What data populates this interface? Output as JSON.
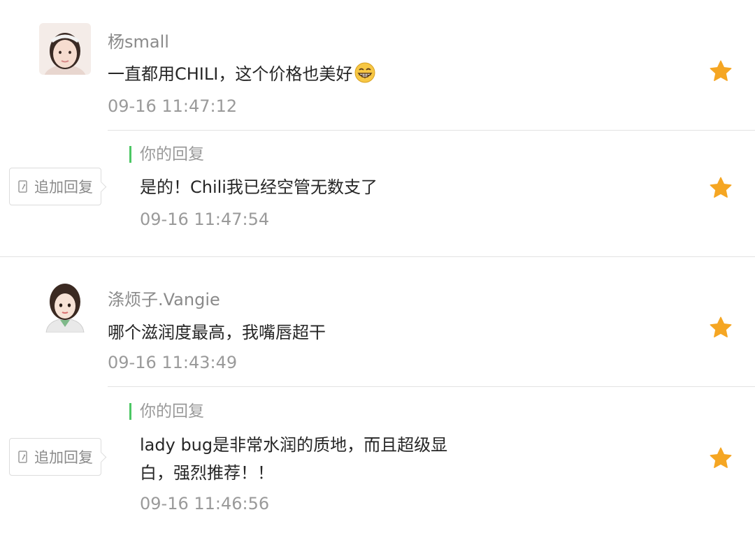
{
  "comments": [
    {
      "username": "杨small",
      "text": "一直都用CHILI，这个价格也美好",
      "emoji": "grinning-face-emoji",
      "time": "09-16 11:47:12",
      "avatar": "avatar-girl-headband",
      "reply": {
        "header": "你的回复",
        "text": "是的！Chili我已经空管无数支了",
        "time": "09-16 11:47:54"
      },
      "add_reply_label": "追加回复"
    },
    {
      "username": "涤烦子.Vangie",
      "text": "哪个滋润度最高，我嘴唇超干",
      "time": "09-16 11:43:49",
      "avatar": "avatar-girl-cartoon",
      "reply": {
        "header": "你的回复",
        "text": "lady bug是非常水润的质地，而且超级显白，强烈推荐！！",
        "time": "09-16 11:46:56"
      },
      "add_reply_label": "追加回复"
    }
  ],
  "colors": {
    "star": "#f5a623",
    "reply_bar": "#4cc764",
    "meta_text": "#9a9a9a"
  },
  "icons": {
    "star": "star-icon",
    "add_reply": "add-reply-icon"
  }
}
